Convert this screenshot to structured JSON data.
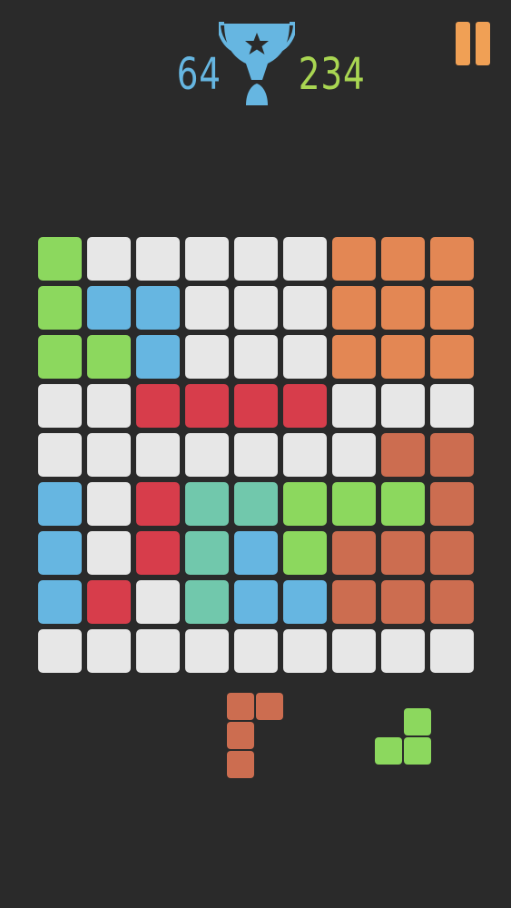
{
  "scores": {
    "current": "64",
    "best": "234"
  },
  "colors": {
    "background": "#2a2a2a",
    "empty": "#e7e7e7",
    "green": "#8cd85e",
    "blue": "#66b6e1",
    "orange": "#e38754",
    "red": "#d73d4b",
    "teal": "#71c8ac",
    "terracotta": "#cc6d50",
    "score_current": "#66b6e1",
    "score_best": "#a9d652",
    "trophy": "#66b6e1",
    "trophy_star": "#2a2a2a",
    "pause": "#f0a055"
  },
  "icons": {
    "trophy": "trophy-star-icon",
    "pause": "pause-icon"
  },
  "board": {
    "rows": 9,
    "cols": 9,
    "grid": [
      [
        "green",
        "empty",
        "empty",
        "empty",
        "empty",
        "empty",
        "orange",
        "orange",
        "orange"
      ],
      [
        "green",
        "blue",
        "blue",
        "empty",
        "empty",
        "empty",
        "orange",
        "orange",
        "orange"
      ],
      [
        "green",
        "green",
        "blue",
        "empty",
        "empty",
        "empty",
        "orange",
        "orange",
        "orange"
      ],
      [
        "empty",
        "empty",
        "red",
        "red",
        "red",
        "red",
        "empty",
        "empty",
        "empty"
      ],
      [
        "empty",
        "empty",
        "empty",
        "empty",
        "empty",
        "empty",
        "empty",
        "terracotta",
        "terracotta"
      ],
      [
        "blue",
        "empty",
        "red",
        "teal",
        "teal",
        "green",
        "green",
        "green",
        "terracotta"
      ],
      [
        "blue",
        "empty",
        "red",
        "teal",
        "blue",
        "green",
        "terracotta",
        "terracotta",
        "terracotta"
      ],
      [
        "blue",
        "red",
        "empty",
        "teal",
        "blue",
        "blue",
        "terracotta",
        "terracotta",
        "terracotta"
      ],
      [
        "empty",
        "empty",
        "empty",
        "empty",
        "empty",
        "empty",
        "empty",
        "empty",
        "empty"
      ]
    ]
  },
  "pieces": [
    {
      "name": "piece-terracotta-l",
      "color": "terracotta",
      "cells": [
        [
          0,
          0
        ],
        [
          1,
          0
        ],
        [
          0,
          1
        ],
        [
          0,
          2
        ]
      ]
    },
    {
      "name": "piece-green-s",
      "color": "green",
      "cells": [
        [
          1,
          0
        ],
        [
          0,
          1
        ],
        [
          1,
          1
        ]
      ]
    }
  ]
}
